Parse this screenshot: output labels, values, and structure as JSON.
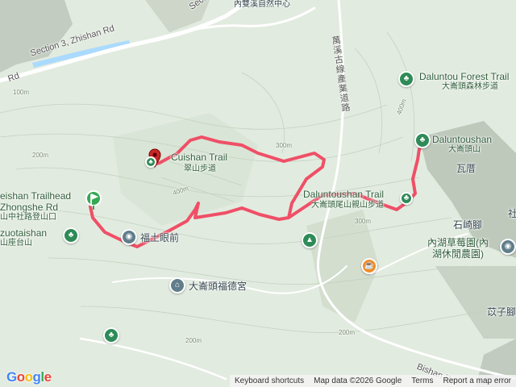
{
  "roads": {
    "section3": "Section 3, Zhishan Rd",
    "section_top": "Section",
    "rd_left": "Rd",
    "bishan": "Bishan Rd",
    "wanxi_vertical": "萬溪古線產業道路",
    "neishuang": "內雙溪自然中心"
  },
  "trails": {
    "cuishan_en": "Cuishan Trail",
    "cuishan_zh": "翠山步道",
    "daluntoushan_trail_en": "Daluntoushan Trail",
    "daluntoushan_trail_zh": "大崙頭尾山親山步道",
    "zhongshe_en": "Zhongshe Rd",
    "zhongshe_zh": "山中社路登山口",
    "trailhead_en": "eishan Trailhead"
  },
  "pois": {
    "daluntou_forest_en": "Daluntou Forest Trail",
    "daluntou_forest_zh": "大崙頭森林步道",
    "daluntoushan_en": "Daluntoushan",
    "daluntoushan_zh": "大崙頭山",
    "zuotaishan_en": "zuotaishan",
    "zuotaishan_zh": "山座台山",
    "futu": "福土眼前",
    "temple": "大崙頭福德宮",
    "strawberry_zh": "內湖草莓園(內",
    "strawberry_zh2": "湖休閒農園)",
    "wawei": "瓦厝",
    "shiqijiao": "石崎腳",
    "zhuzijiao": "苡子腳",
    "right_edge": "社"
  },
  "elevations": [
    "100m",
    "200m",
    "200m",
    "300m",
    "300m",
    "400m",
    "400m",
    "200m"
  ],
  "footer": {
    "google": "Google",
    "shortcuts": "Keyboard shortcuts",
    "mapdata": "Map data ©2026 Google",
    "terms": "Terms",
    "report": "Report a map error"
  },
  "colors": {
    "route": "#ef4f67",
    "terrain": "#dfe9dc",
    "road": "#ffffff",
    "water": "#aadaff"
  },
  "icons": [
    "flag-icon",
    "destination-pin-icon",
    "tree-icon",
    "camping-icon",
    "cafe-icon",
    "temple-icon",
    "viewpoint-icon"
  ]
}
